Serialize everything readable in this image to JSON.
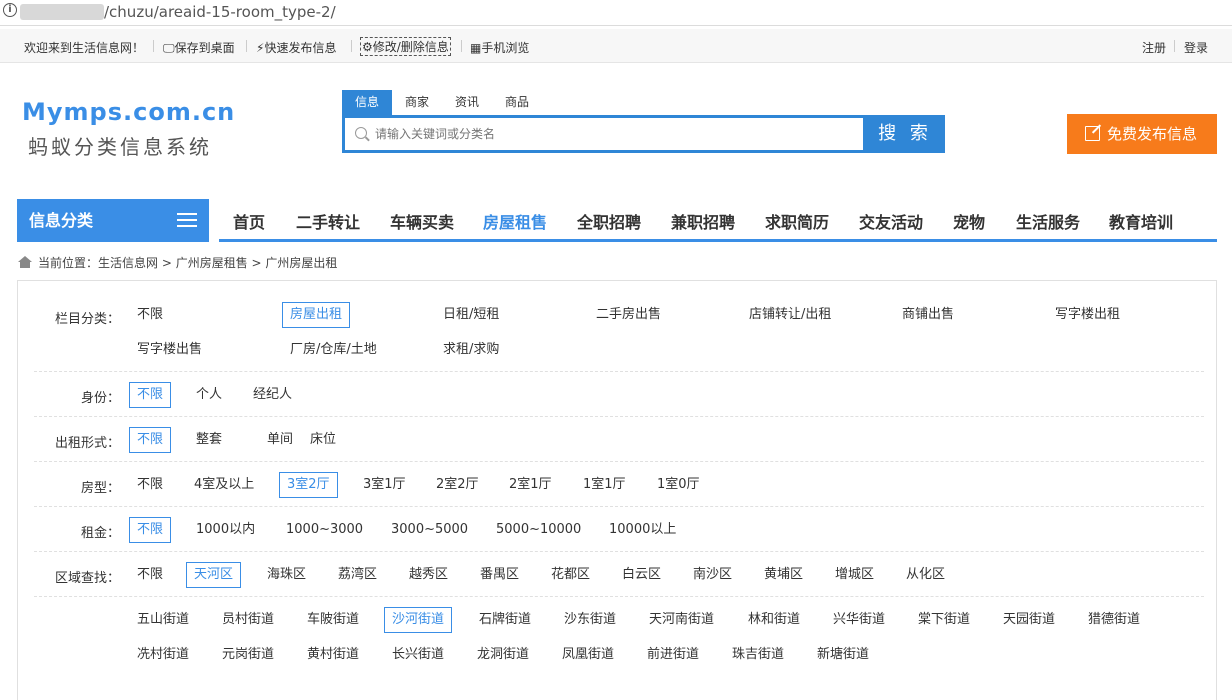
{
  "browser": {
    "url_path": "/chuzu/areaid-15-room_type-2/",
    "info_icon": "i"
  },
  "topbar": {
    "welcome": "欢迎来到生活信息网！",
    "save_desktop": "保存到桌面",
    "quick_post": "快速发布信息",
    "edit_delete": "修改/删除信息",
    "mobile": "手机浏览",
    "register": "注册",
    "login": "登录",
    "icons": {
      "save": "monitor-icon",
      "quick": "lightning-icon",
      "edit": "gear-icon",
      "mobile": "qrcode-icon"
    }
  },
  "logo": {
    "line1": "Mymps.com.cn",
    "line2": "蚂蚁分类信息系统"
  },
  "search": {
    "tabs": [
      "信息",
      "商家",
      "资讯",
      "商品"
    ],
    "active_tab": "信息",
    "placeholder": "请输入关键词或分类名",
    "button": "搜 索"
  },
  "post_button": "免费发布信息",
  "category_box": {
    "label": "信息分类",
    "icon": "menu-icon"
  },
  "nav": {
    "items": [
      "首页",
      "二手转让",
      "车辆买卖",
      "房屋租售",
      "全职招聘",
      "兼职招聘",
      "求职简历",
      "交友活动",
      "宠物",
      "生活服务",
      "教育培训"
    ],
    "active": "房屋租售"
  },
  "breadcrumb": {
    "prefix": "当前位置：",
    "items": [
      "生活信息网",
      "广州房屋租售",
      "广州房屋出租"
    ],
    "sep": " > "
  },
  "filters": {
    "column": {
      "label": "栏目分类：",
      "options": [
        "不限",
        "房屋出租",
        "日租/短租",
        "二手房出售",
        "店铺转让/出租",
        "商铺出售",
        "写字楼出租",
        "写字楼出售",
        "厂房/仓库/土地",
        "求租/求购"
      ],
      "selected": "房屋出租"
    },
    "identity": {
      "label": "身份：",
      "options": [
        "不限",
        "个人",
        "经纪人"
      ],
      "selected": "不限"
    },
    "rent_type": {
      "label": "出租形式：",
      "options": [
        "不限",
        "整套",
        "单间",
        "床位"
      ],
      "selected": "不限"
    },
    "room_type": {
      "label": "房型：",
      "options": [
        "不限",
        "4室及以上",
        "3室2厅",
        "3室1厅",
        "2室2厅",
        "2室1厅",
        "1室1厅",
        "1室0厅"
      ],
      "selected": "3室2厅"
    },
    "rent": {
      "label": "租金：",
      "options": [
        "不限",
        "1000以内",
        "1000~3000",
        "3000~5000",
        "5000~10000",
        "10000以上"
      ],
      "selected": "不限"
    },
    "area": {
      "label": "区域查找：",
      "options": [
        "不限",
        "天河区",
        "海珠区",
        "荔湾区",
        "越秀区",
        "番禺区",
        "花都区",
        "白云区",
        "南沙区",
        "黄埔区",
        "增城区",
        "从化区"
      ],
      "selected": "天河区"
    },
    "street": {
      "options": [
        "五山街道",
        "员村街道",
        "车陂街道",
        "沙河街道",
        "石牌街道",
        "沙东街道",
        "天河南街道",
        "林和街道",
        "兴华街道",
        "棠下街道",
        "天园街道",
        "猎德街道",
        "冼村街道",
        "元岗街道",
        "黄村街道",
        "长兴街道",
        "龙洞街道",
        "凤凰街道",
        "前进街道",
        "珠吉街道",
        "新塘街道"
      ],
      "selected": "沙河街道"
    }
  }
}
